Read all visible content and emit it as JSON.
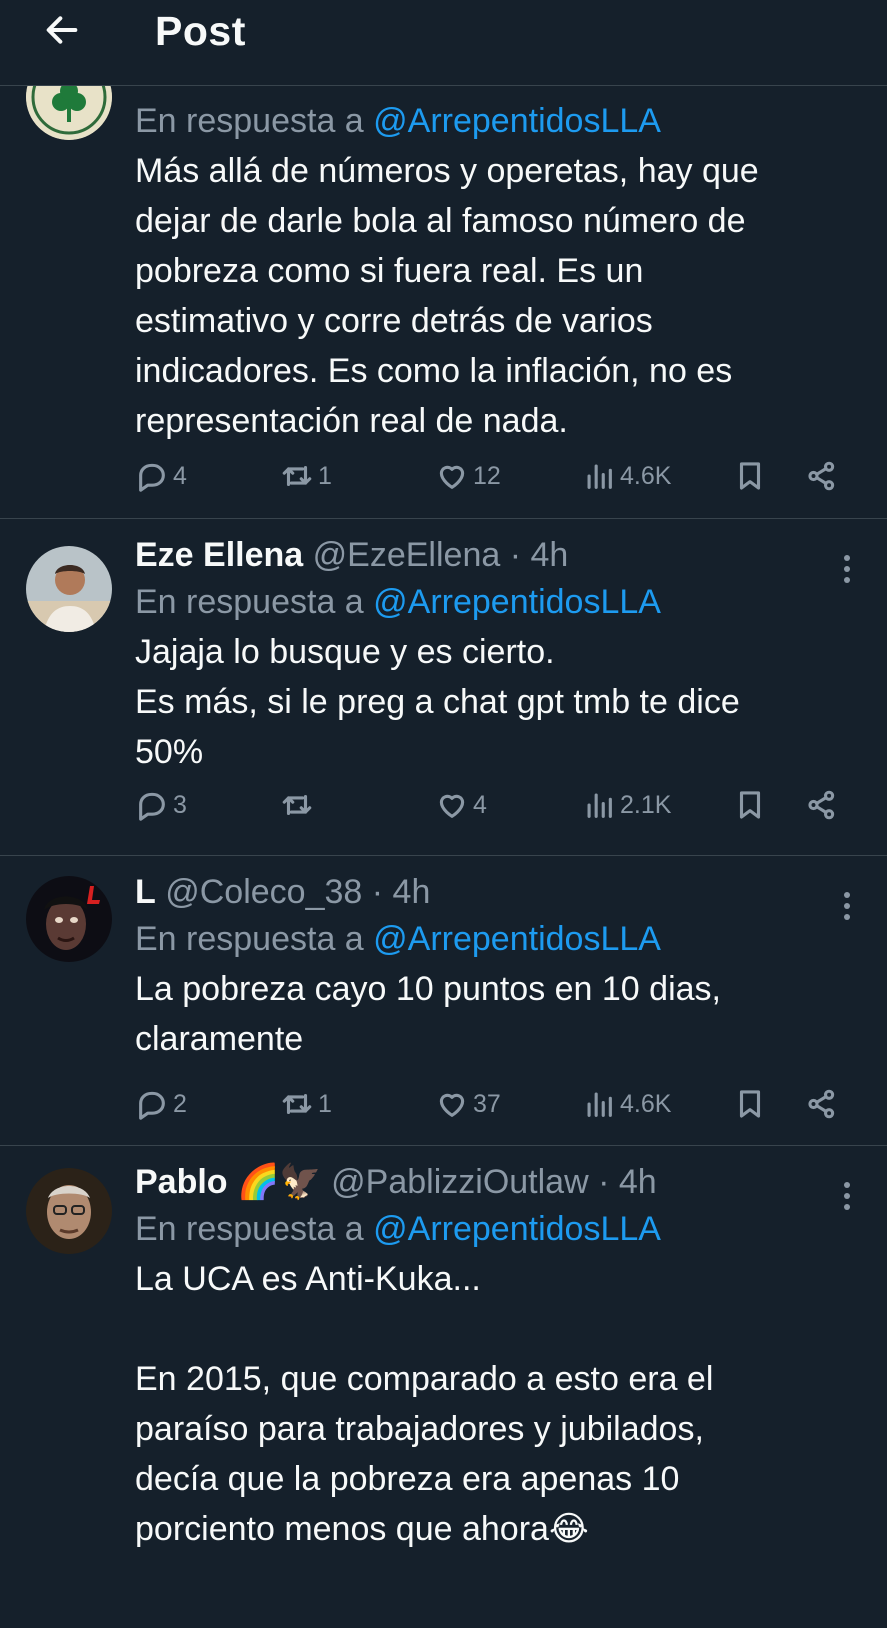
{
  "header": {
    "title": "Post"
  },
  "colors": {
    "background": "#15202b",
    "accent": "#1d9bf0",
    "muted": "#8b98a5",
    "border": "#38444d"
  },
  "tweets": [
    {
      "name": "",
      "handle": "",
      "time": "",
      "reply_prefix": "En respuesta a",
      "reply_to": "@ArrepentidosLLA",
      "text": "Más allá de números y operetas, hay que\ndejar de darle bola al famoso número de\npobreza como si fuera real. Es un\nestimativo y corre detrás de varios\nindicadores. Es como la inflación, no es\nrepresentación real de nada.",
      "replies": "4",
      "reposts": "1",
      "likes": "12",
      "views": "4.6K",
      "avatar_icon": "clover-avatar"
    },
    {
      "name": "Eze Ellena",
      "handle": "@EzeEllena",
      "time": "4h",
      "reply_prefix": "En respuesta a",
      "reply_to": "@ArrepentidosLLA",
      "text": "Jajaja lo busque y es cierto.\nEs más, si le preg a chat gpt tmb te dice\n50%",
      "replies": "3",
      "reposts": "",
      "likes": "4",
      "views": "2.1K",
      "avatar_icon": "person-avatar"
    },
    {
      "name": "L",
      "handle": "@Coleco_38",
      "time": "4h",
      "reply_prefix": "En respuesta a",
      "reply_to": "@ArrepentidosLLA",
      "text": "La pobreza cayo 10 puntos en 10 dias,\nclaramente",
      "replies": "2",
      "reposts": "1",
      "likes": "37",
      "views": "4.6K",
      "avatar_icon": "face-avatar"
    },
    {
      "name": "Pablo 🌈🦅",
      "handle": "@PablizziOutlaw",
      "time": "4h",
      "reply_prefix": "En respuesta a",
      "reply_to": "@ArrepentidosLLA",
      "text": "La UCA es Anti-Kuka...\n\nEn 2015, que comparado a esto era el\nparaíso para trabajadores y jubilados,\ndecía que la pobreza era apenas 10\nporciento menos que ahora😂",
      "replies": "",
      "reposts": "",
      "likes": "",
      "views": "",
      "avatar_icon": "old-man-avatar"
    }
  ],
  "separator": "·"
}
